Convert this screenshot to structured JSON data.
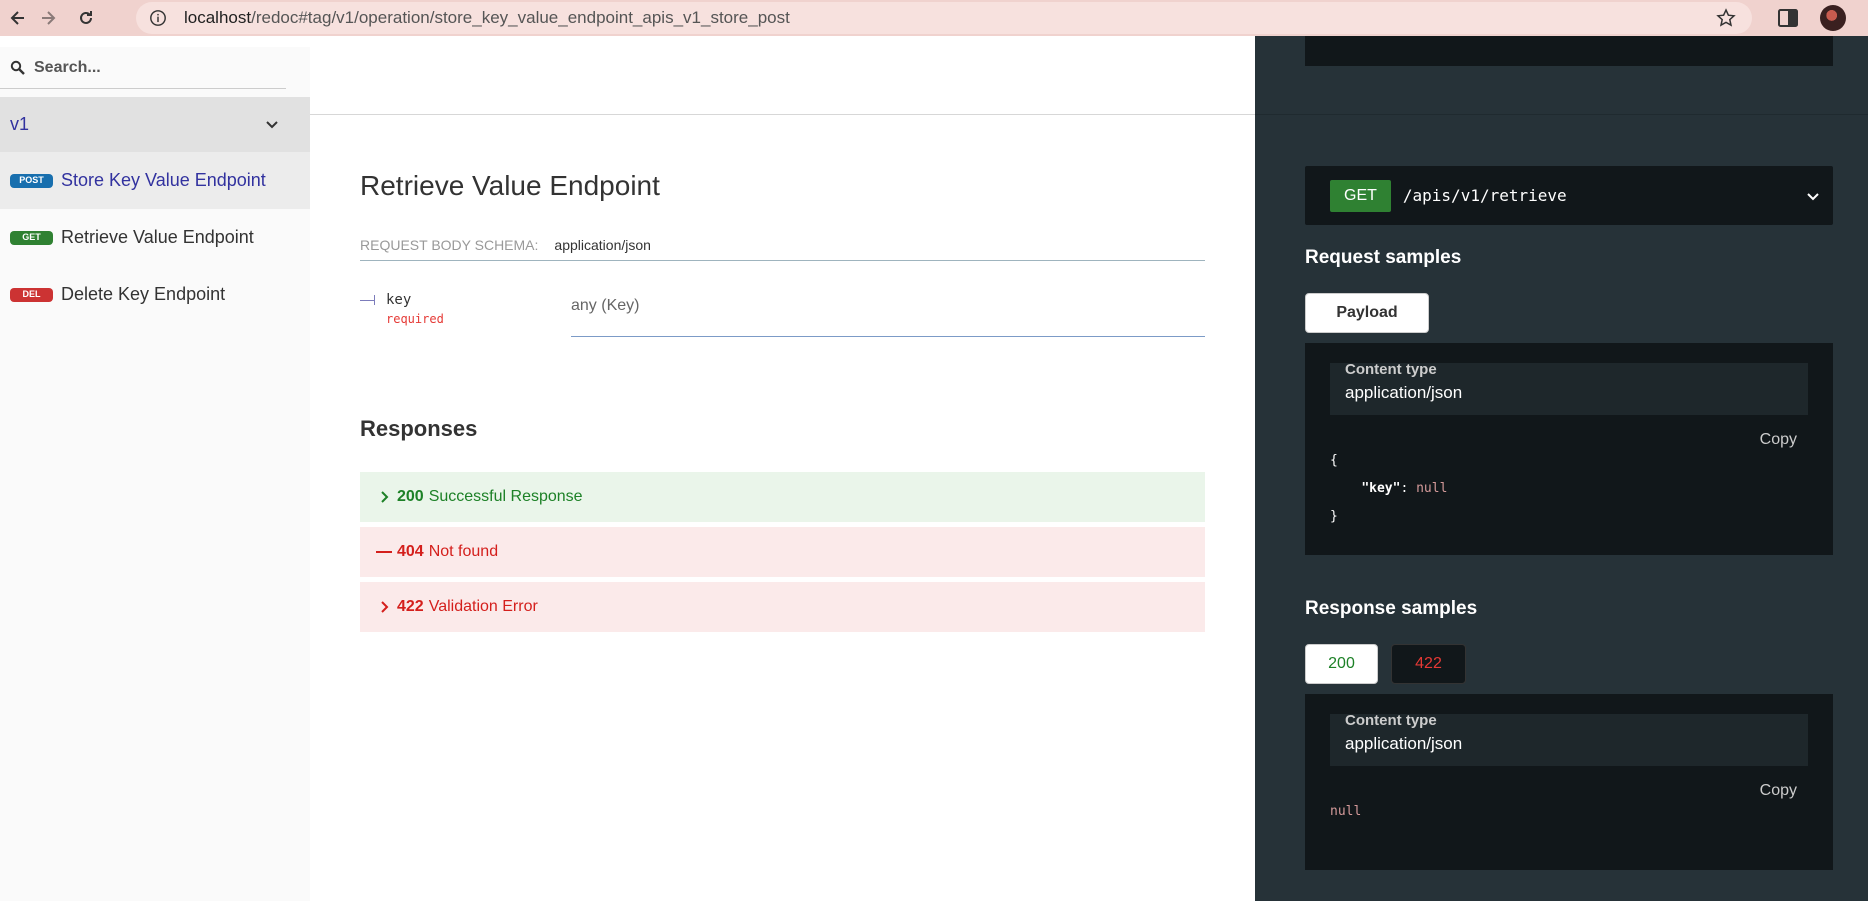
{
  "browser": {
    "url_host": "localhost",
    "url_path": "/redoc#tag/v1/operation/store_key_value_endpoint_apis_v1_store_post"
  },
  "sidebar": {
    "search_placeholder": "Search...",
    "group": "v1",
    "items": [
      {
        "method": "POST",
        "label": "Store Key Value Endpoint",
        "active": true
      },
      {
        "method": "GET",
        "label": "Retrieve Value Endpoint",
        "active": false
      },
      {
        "method": "DEL",
        "label": "Delete Key Endpoint",
        "active": false
      }
    ]
  },
  "operation": {
    "title": "Retrieve Value Endpoint",
    "schema_label": "REQUEST BODY SCHEMA:",
    "schema_type": "application/json",
    "property": {
      "name": "key",
      "required": "required",
      "type": "any (Key)"
    },
    "responses_title": "Responses",
    "responses": [
      {
        "code": "200",
        "desc": "Successful Response",
        "state": "collapsed"
      },
      {
        "code": "404",
        "desc": "Not found",
        "state": "expanded"
      },
      {
        "code": "422",
        "desc": "Validation Error",
        "state": "collapsed"
      }
    ]
  },
  "panel": {
    "endpoint_method": "GET",
    "endpoint_path": "/apis/v1/retrieve",
    "request_samples_title": "Request samples",
    "payload_tab": "Payload",
    "request_content_type_label": "Content type",
    "request_content_type": "application/json",
    "copy_label": "Copy",
    "request_code": {
      "open": "{",
      "key": "\"key\"",
      "colon": ": ",
      "value": "null",
      "close": "}"
    },
    "response_samples_title": "Response samples",
    "response_tabs": [
      "200",
      "422"
    ],
    "response_content_type_label": "Content type",
    "response_content_type": "application/json",
    "response_code": "null"
  },
  "colors": {
    "post": "#186fae",
    "get": "#2f8132",
    "del": "#cc3333",
    "success": "#1d8127",
    "error": "#d41f1c",
    "panel_bg": "#263238"
  }
}
